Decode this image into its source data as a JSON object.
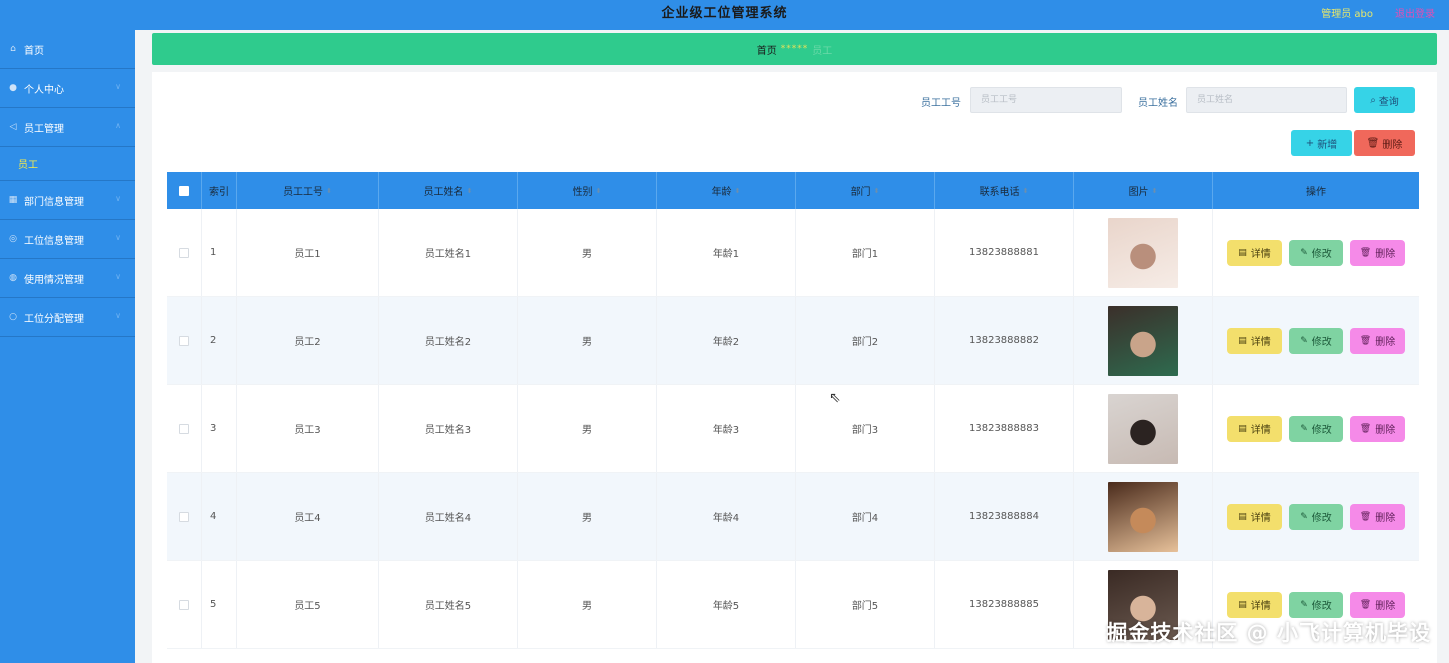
{
  "header": {
    "title": "企业级工位管理系统",
    "user": "管理员 abo",
    "logout": "退出登录"
  },
  "sidebar": {
    "items": [
      {
        "label": "首页",
        "icon": "home-icon"
      },
      {
        "label": "个人中心",
        "icon": "user-icon"
      },
      {
        "label": "员工管理",
        "icon": "users-icon",
        "children": [
          {
            "label": "员工"
          }
        ]
      },
      {
        "label": "部门信息管理",
        "icon": "building-icon"
      },
      {
        "label": "工位信息管理",
        "icon": "desk-icon"
      },
      {
        "label": "使用情况管理",
        "icon": "chart-icon"
      },
      {
        "label": "工位分配管理",
        "icon": "assign-icon"
      }
    ]
  },
  "breadcrumb": {
    "home": "首页",
    "separator": "*****",
    "current": "员工"
  },
  "search": {
    "employee_no_label": "员工工号",
    "employee_no_placeholder": "员工工号",
    "employee_name_label": "员工姓名",
    "employee_name_placeholder": "员工姓名",
    "query_label": "查询"
  },
  "actions": {
    "add_label": "新增",
    "delete_label": "删除"
  },
  "table": {
    "columns": [
      "索引",
      "员工工号",
      "员工姓名",
      "性别",
      "年龄",
      "部门",
      "联系电话",
      "图片",
      "操作"
    ],
    "op_labels": {
      "detail": "详情",
      "edit": "修改",
      "delete": "删除"
    },
    "rows": [
      {
        "index": "1",
        "no": "员工1",
        "name": "员工姓名1",
        "gender": "男",
        "age": "年龄1",
        "dept": "部门1",
        "phone": "13823888881"
      },
      {
        "index": "2",
        "no": "员工2",
        "name": "员工姓名2",
        "gender": "男",
        "age": "年龄2",
        "dept": "部门2",
        "phone": "13823888882"
      },
      {
        "index": "3",
        "no": "员工3",
        "name": "员工姓名3",
        "gender": "男",
        "age": "年龄3",
        "dept": "部门3",
        "phone": "13823888883"
      },
      {
        "index": "4",
        "no": "员工4",
        "name": "员工姓名4",
        "gender": "男",
        "age": "年龄4",
        "dept": "部门4",
        "phone": "13823888884"
      },
      {
        "index": "5",
        "no": "员工5",
        "name": "员工姓名5",
        "gender": "男",
        "age": "年龄5",
        "dept": "部门5",
        "phone": "13823888885"
      }
    ]
  },
  "watermark": "掘金技术社区 @ 小飞计算机毕设",
  "colors": {
    "primary": "#2f8ee8",
    "breadcrumb_bg": "#2fcb8d",
    "detail_btn": "#f3df6c",
    "edit_btn": "#7fd3a2",
    "delete_btn": "#f58ae8"
  }
}
